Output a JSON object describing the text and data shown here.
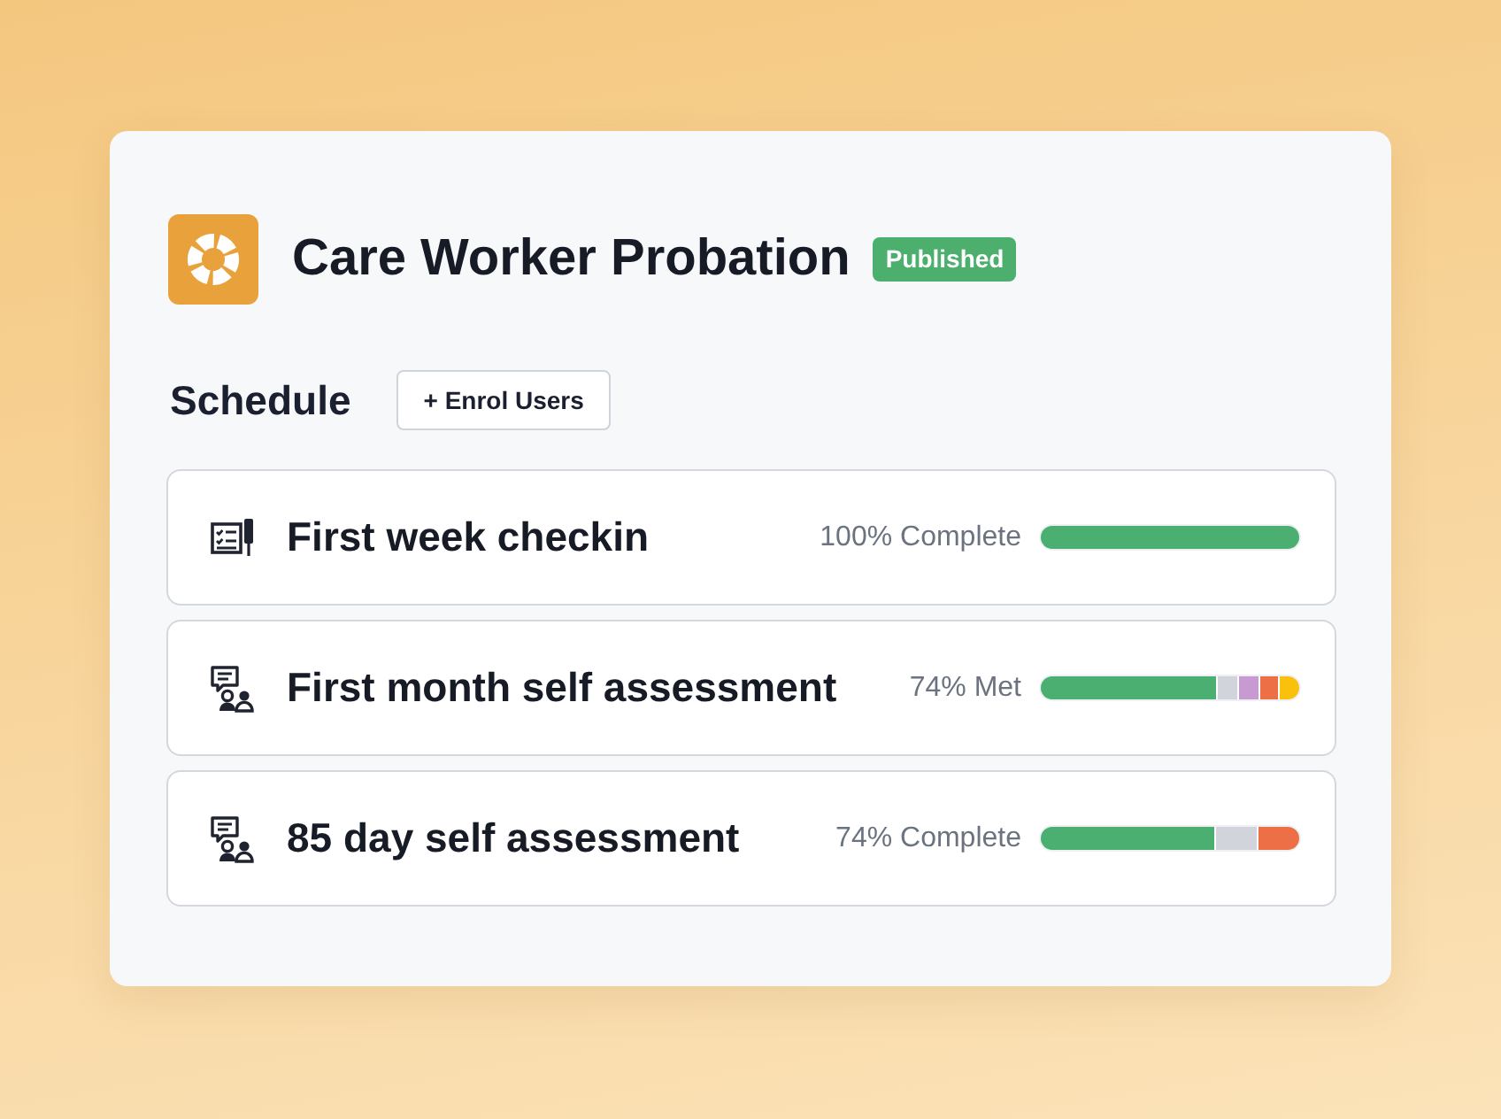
{
  "course": {
    "title": "Care Worker Probation",
    "status": "Published"
  },
  "schedule": {
    "heading": "Schedule",
    "enrol_button": "+ Enrol Users"
  },
  "rows": [
    {
      "kind": "checklist",
      "title": "First week checkin",
      "reading": "100% Complete",
      "progress": {
        "level": 1
      }
    },
    {
      "kind": "discussion",
      "title": "First month self assessment",
      "reading": "74% Met",
      "progress": {
        "level": 0.68,
        "rest": [
          {
            "color": "#d1d5db"
          },
          {
            "color": "#c79bd1"
          },
          {
            "color": "#ec6f45"
          },
          {
            "color": "#f9c10b"
          }
        ]
      }
    },
    {
      "kind": "discussion",
      "title": "85 day self assessment",
      "reading": "74% Complete",
      "progress": {
        "level": 0.67,
        "rest": [
          {
            "color": "#d1d5db"
          },
          {
            "color": "#ec6f45"
          }
        ]
      }
    }
  ]
}
